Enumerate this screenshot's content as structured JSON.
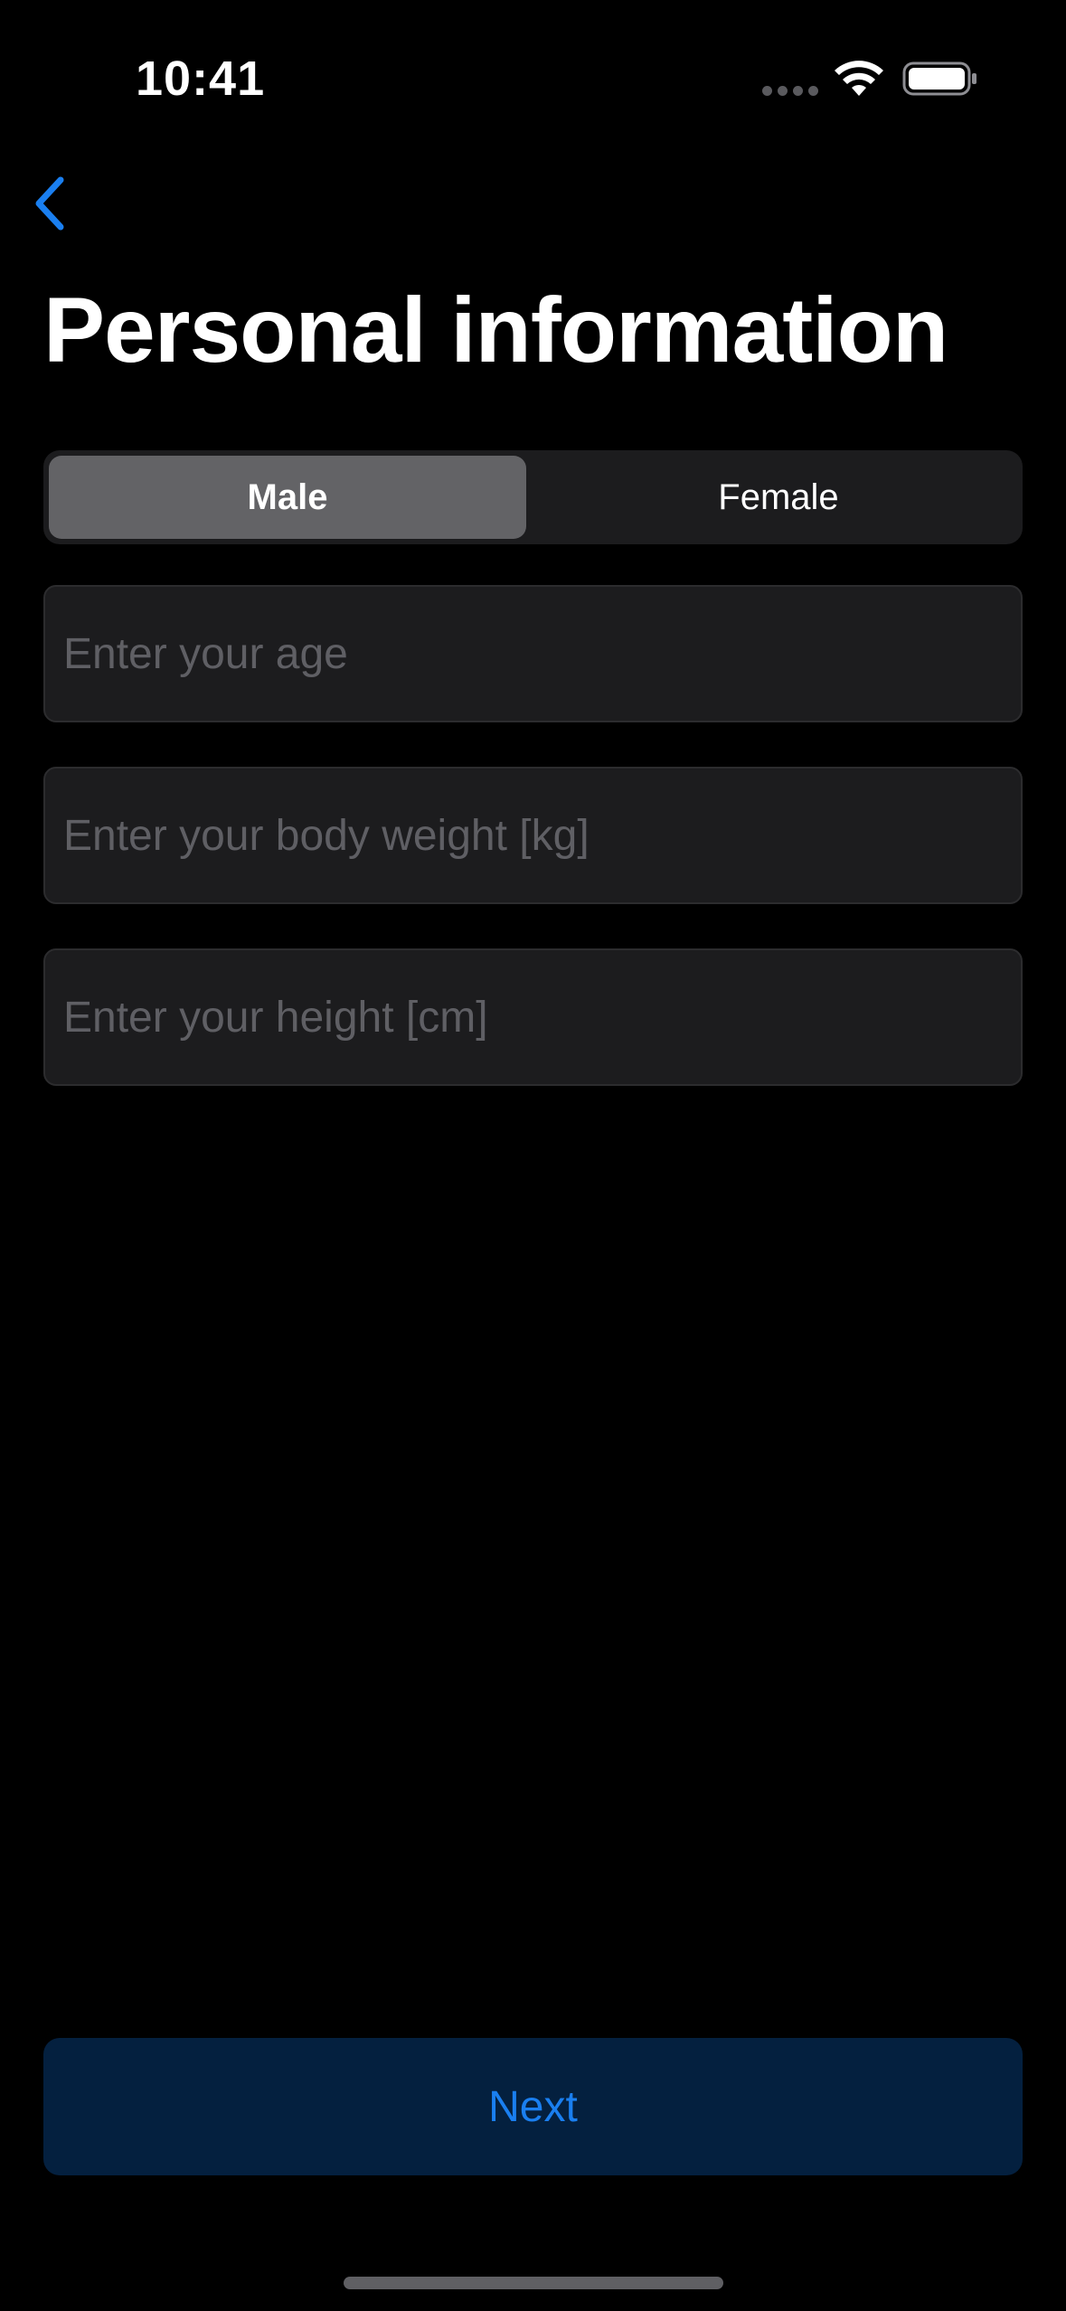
{
  "status_bar": {
    "time": "10:41"
  },
  "nav": {
    "back_icon": "chevron-left-icon"
  },
  "header": {
    "title": "Personal information"
  },
  "gender_selector": {
    "options": [
      "Male",
      "Female"
    ],
    "selected": "Male"
  },
  "form": {
    "age_placeholder": "Enter your age",
    "weight_placeholder": "Enter your body weight [kg]",
    "height_placeholder": "Enter your height [cm]"
  },
  "footer": {
    "next_label": "Next"
  },
  "colors": {
    "accent": "#1a7ff0",
    "background": "#000000",
    "field_background": "#1c1c1e",
    "segment_selected": "#636366",
    "next_button_background": "#04203f"
  }
}
